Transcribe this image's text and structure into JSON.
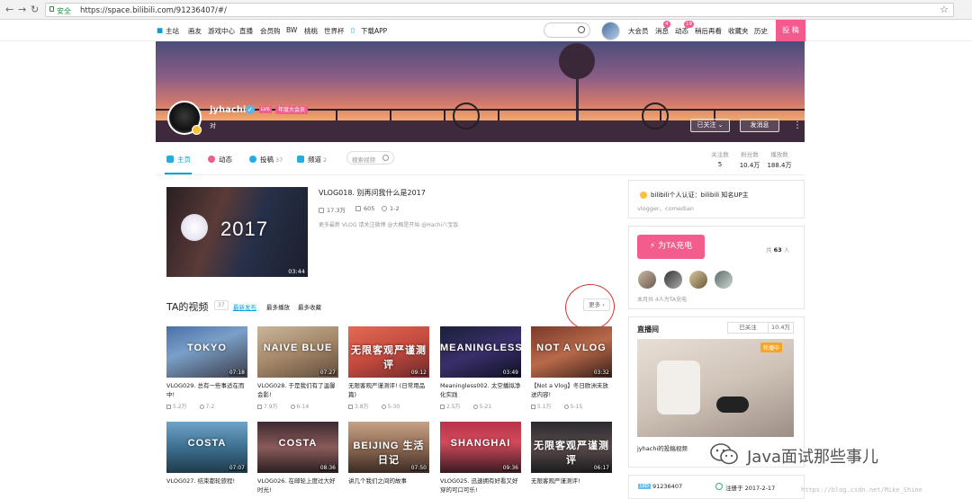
{
  "browser": {
    "secure_label": "安全",
    "url": "https://space.bilibili.com/91236407/#/"
  },
  "site_nav": {
    "items": [
      "主站",
      "画友",
      "游戏中心",
      "直播",
      "会员购",
      "BW",
      "桃桃",
      "世界杯",
      "下载APP"
    ],
    "search_placeholder": "",
    "right": {
      "vip": "大会员",
      "messages": "消息",
      "messages_badge": "4",
      "dynamic": "动态",
      "dynamic_badge": "19",
      "watch_later": "稍后再看",
      "favorites": "收藏夹",
      "history": "历史",
      "upload": "投 稿"
    }
  },
  "profile": {
    "username": "jyhachi",
    "level": "LV6",
    "vip_badge": "年度大会员",
    "sign": "对",
    "follow_button": "已关注",
    "message_button": "发消息",
    "more": "⋮"
  },
  "tabs": [
    {
      "label": "主页",
      "count": "",
      "color": "#23ade5"
    },
    {
      "label": "动态",
      "count": "",
      "color": "#f25d8e"
    },
    {
      "label": "投稿",
      "count": "37",
      "color": "#23ade5"
    },
    {
      "label": "频道",
      "count": "2",
      "color": "#23ade5"
    }
  ],
  "tab_search_placeholder": "搜索视频",
  "stats": [
    {
      "label": "关注数",
      "value": "5"
    },
    {
      "label": "粉丝数",
      "value": "10.4万"
    },
    {
      "label": "播放数",
      "value": "188.4万"
    }
  ],
  "featured": {
    "title": "VLOG018. 别再问我什么是2017",
    "thumb_text": "2017",
    "duration": "03:44",
    "plays": "17.3万",
    "comments": "605",
    "date": "1-2",
    "desc": "更多最新 VLOG 请关注微博 @大概是开始 @Hachi八宝饭"
  },
  "videos_section": {
    "title": "TA的视频",
    "count": "37",
    "sort_options": [
      "最新发布",
      "最多播放",
      "最多收藏"
    ],
    "more": "更多"
  },
  "videos": [
    {
      "thumb_text": "TOKYO",
      "duration": "07:18",
      "title": "VLOG029. 总有一些事适在而中!",
      "plays": "5.2万",
      "date": "7-2",
      "bg": "linear-gradient(160deg,#4a6fa8 0%,#7aa0c8 40%,#3c3c4a 100%)"
    },
    {
      "thumb_text": "NAIVE BLUE",
      "duration": "07:27",
      "title": "VLOG028. 于是我们有了温馨会影!",
      "plays": "7.9万",
      "date": "6-14",
      "bg": "linear-gradient(160deg,#c8b59a 0%,#a48768 50%,#5f4a3b 100%)"
    },
    {
      "thumb_text": "无限客观严谨测评",
      "duration": "09:12",
      "title": "无限客观严谨测评! (日常用品篇)",
      "plays": "3.8万",
      "date": "5-30",
      "bg": "linear-gradient(160deg,#e06b55 0%,#c44a3e 50%,#6a2a2a 100%)"
    },
    {
      "thumb_text": "MEANINGLESS",
      "duration": "03:49",
      "title": "Meaningless002. 太空播拟净化实践",
      "plays": "2.5万",
      "date": "5-21",
      "bg": "linear-gradient(160deg,#1a1f3a 0%,#3a2f6a 50%,#0e1024 100%)"
    },
    {
      "thumb_text": "NOT A VLOG",
      "duration": "03:32",
      "title": "【Not a Vlog】冬日欧洲未放送内容!",
      "plays": "5.1万",
      "date": "5-15",
      "bg": "linear-gradient(160deg,#7a3a2a 0%,#b86a4a 50%,#3a1f18 100%)"
    },
    {
      "thumb_text": "COSTA",
      "duration": "07:07",
      "title": "VLOG027. 结束都轮旅程!",
      "plays": "",
      "date": "",
      "bg": "linear-gradient(180deg,#6fa4c8 0%,#3d6f8f 50%,#1f3a4a 100%)"
    },
    {
      "thumb_text": "COSTA",
      "duration": "08:36",
      "title": "VLOG026. 在邮轮上度过大好时光!",
      "plays": "",
      "date": "",
      "bg": "linear-gradient(180deg,#3c2a30 0%,#8a5a5a 50%,#2a1f22 100%)"
    },
    {
      "thumb_text": "BEIJING 生活日记",
      "duration": "07:50",
      "title": "讲几个我们之间的故事",
      "plays": "",
      "date": "",
      "bg": "linear-gradient(180deg,#c7a287 0%,#8e6a54 50%,#3a2a22 100%)"
    },
    {
      "thumb_text": "SHANGHAI",
      "duration": "09:36",
      "title": "VLOG025. 迅速拥有好看又好穿的可口可乐!",
      "plays": "",
      "date": "",
      "bg": "linear-gradient(180deg,#b8324a 0%,#d24a5a 40%,#3a1a22 100%)"
    },
    {
      "thumb_text": "无限客观严谨测评",
      "duration": "06:17",
      "title": "无限客观严谨测评!",
      "plays": "",
      "date": "",
      "bg": "linear-gradient(180deg,#2a2a30 0%,#5a4a4a 50%,#1a1a1f 100%)"
    }
  ],
  "sidebar": {
    "auth_text": "bilibili个人认证：bilibili 知名UP主",
    "auth_sub": "vlogger、comedian",
    "charge_button": "为TA充电",
    "charge_count_prefix": "共",
    "charge_count": "63",
    "charge_count_suffix": "人",
    "charge_note": "本月共 4人为TA充电",
    "live_title": "直播间",
    "live_follow": "已关注",
    "live_follow_count": "10.4万",
    "live_tag": "轮播中",
    "live_caption": "jyhachi的投稿视频",
    "uid_tag": "UID",
    "uid": "91236407",
    "registered": "注册于 2017-2-17"
  },
  "watermark": {
    "text": "Java面试那些事儿",
    "url": "https://blog.csdn.net/Mike_Shine"
  }
}
